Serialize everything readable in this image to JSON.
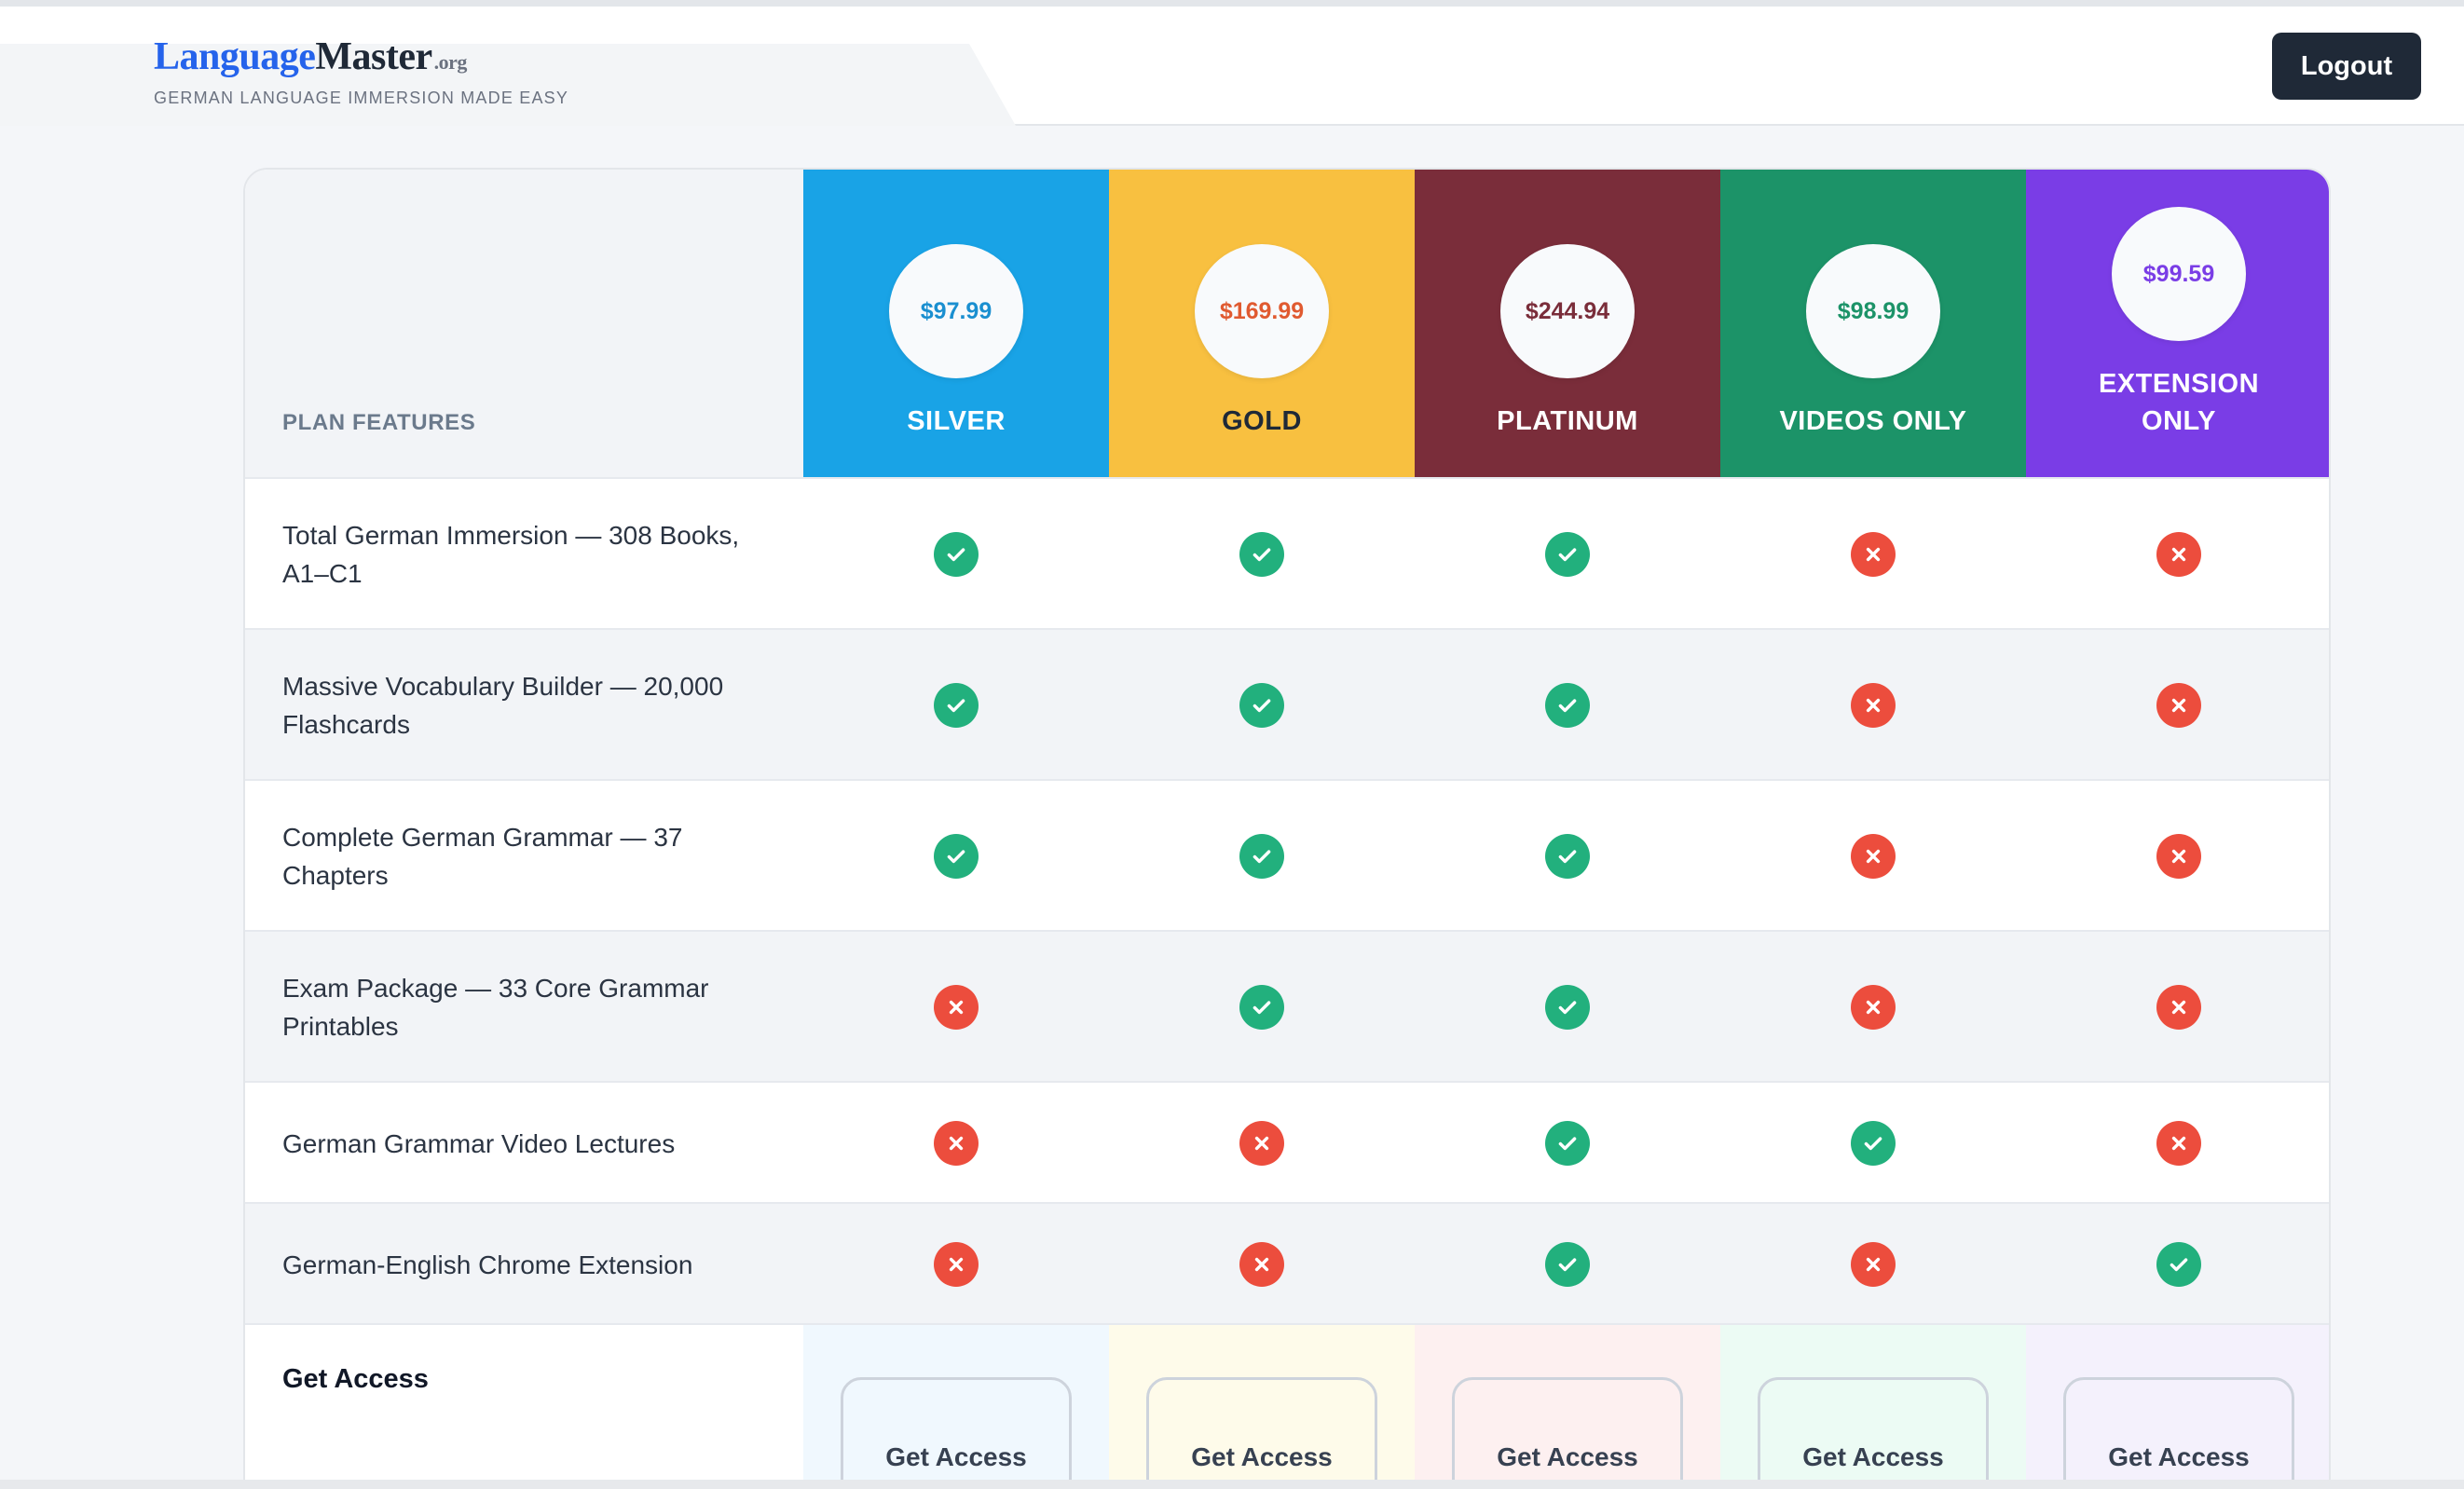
{
  "header": {
    "logo_part1": "Language",
    "logo_part2": "Master",
    "logo_part3": ".org",
    "tagline": "GERMAN LANGUAGE IMMERSION MADE EASY",
    "logout_label": "Logout"
  },
  "table": {
    "features_header": "PLAN FEATURES",
    "plans": [
      {
        "name": "SILVER",
        "price": "$97.99",
        "bg": "#19a3e6",
        "price_color": "#1a8fd0",
        "name_color": "#ffffff",
        "access_bg": "#f0f8fe"
      },
      {
        "name": "GOLD",
        "price": "$169.99",
        "bg": "#f8c040",
        "price_color": "#e05a30",
        "name_color": "#1f2937",
        "access_bg": "#fefbea"
      },
      {
        "name": "PLATINUM",
        "price": "$244.94",
        "bg": "#7a2d3a",
        "price_color": "#7a2d3a",
        "name_color": "#ffffff",
        "access_bg": "#fdf0f0"
      },
      {
        "name": "VIDEOS ONLY",
        "price": "$98.99",
        "bg": "#1c9368",
        "price_color": "#1c9368",
        "name_color": "#ffffff",
        "access_bg": "#ecfbf4"
      },
      {
        "name": "EXTENSION ONLY",
        "price": "$99.59",
        "bg": "#7a3de6",
        "price_color": "#7a3de6",
        "name_color": "#ffffff",
        "access_bg": "#f4f1fc"
      }
    ],
    "rows": [
      {
        "feature": "Total German Immersion — 308 Books, A1–C1",
        "marks": [
          true,
          true,
          true,
          false,
          false
        ]
      },
      {
        "feature": "Massive Vocabulary Builder — 20,000 Flashcards",
        "marks": [
          true,
          true,
          true,
          false,
          false
        ]
      },
      {
        "feature": "Complete German Grammar — 37 Chapters",
        "marks": [
          true,
          true,
          true,
          false,
          false
        ]
      },
      {
        "feature": "Exam Package — 33 Core Grammar Printables",
        "marks": [
          false,
          true,
          true,
          false,
          false
        ]
      },
      {
        "feature": "German Grammar Video Lectures",
        "marks": [
          false,
          false,
          true,
          true,
          false
        ]
      },
      {
        "feature": "German-English Chrome Extension",
        "marks": [
          false,
          false,
          true,
          false,
          true
        ]
      }
    ],
    "access_label": "Get Access",
    "access_button_label": "Get Access"
  },
  "colors": {
    "check": "#22b07d",
    "cross": "#ec4d3d"
  },
  "icons": {
    "check": "check-icon",
    "cross": "cross-icon"
  }
}
